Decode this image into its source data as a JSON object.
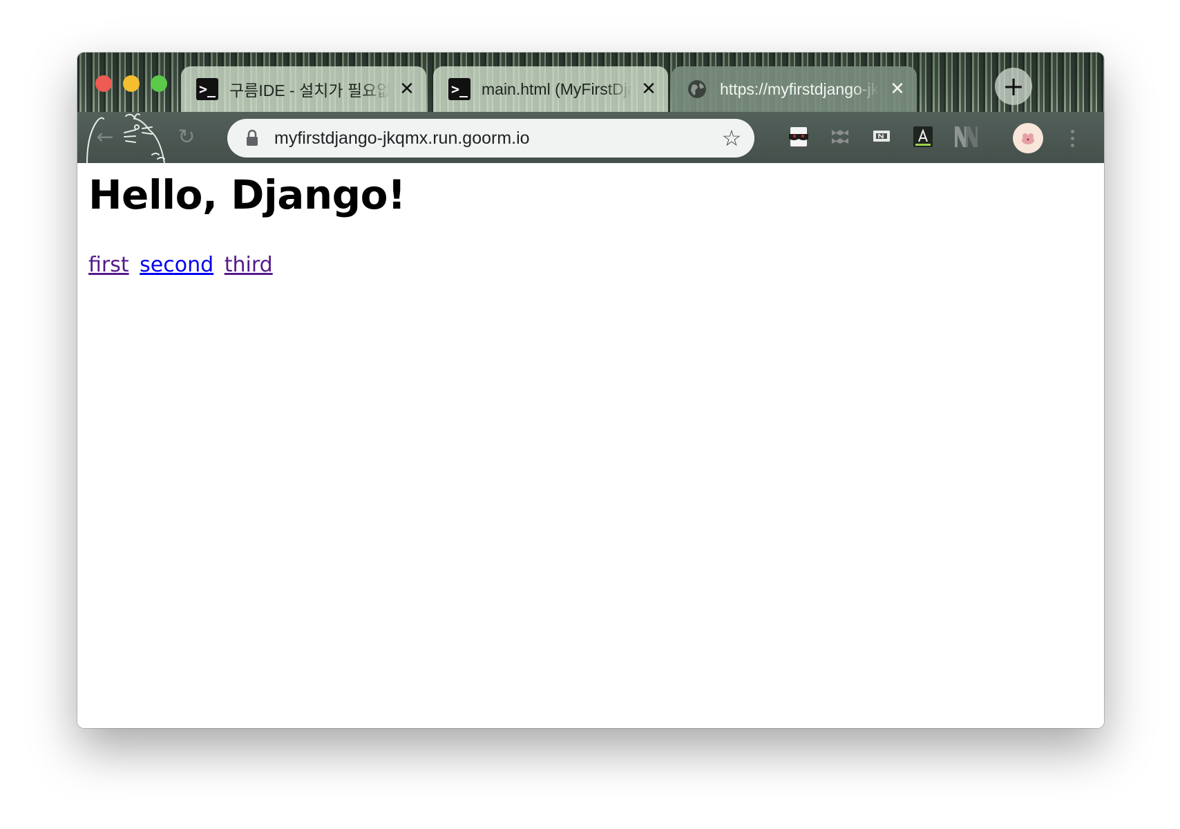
{
  "window": {
    "traffic_lights": [
      "close",
      "minimize",
      "zoom"
    ]
  },
  "tabs": [
    {
      "title": "구름IDE - 설치가 필요없는 통합개발환경 서비스",
      "icon": "terminal-icon",
      "favicon_glyph": ">_",
      "active": false
    },
    {
      "title": "main.html (MyFirstDjango)",
      "icon": "terminal-icon",
      "favicon_glyph": ">_",
      "active": false
    },
    {
      "title": "https://myfirstdjango-jkqmx.run.goorm.io",
      "icon": "globe-icon",
      "active": true
    }
  ],
  "tab_close_glyph": "✕",
  "new_tab_glyph": "+",
  "toolbar": {
    "back_glyph": "←",
    "reload_glyph": "↻",
    "address": "myfirstdjango-jkqmx.run.goorm.io",
    "star_glyph": "☆",
    "extensions": [
      "mask-icon",
      "tabs-puzzle-icon",
      "naver-note-icon",
      "dictionary-a-icon",
      "nn-icon"
    ],
    "profile": "avatar"
  },
  "page": {
    "heading": "Hello, Django!",
    "links": [
      {
        "label": "first",
        "visited": true
      },
      {
        "label": "second",
        "visited": false
      },
      {
        "label": "third",
        "visited": true
      }
    ]
  },
  "colors": {
    "link_visited": "#551a8b",
    "link_unvisited": "#0000ee",
    "traffic_close": "#ee5b52",
    "traffic_min": "#f5be2f",
    "traffic_max": "#5bc94a"
  }
}
